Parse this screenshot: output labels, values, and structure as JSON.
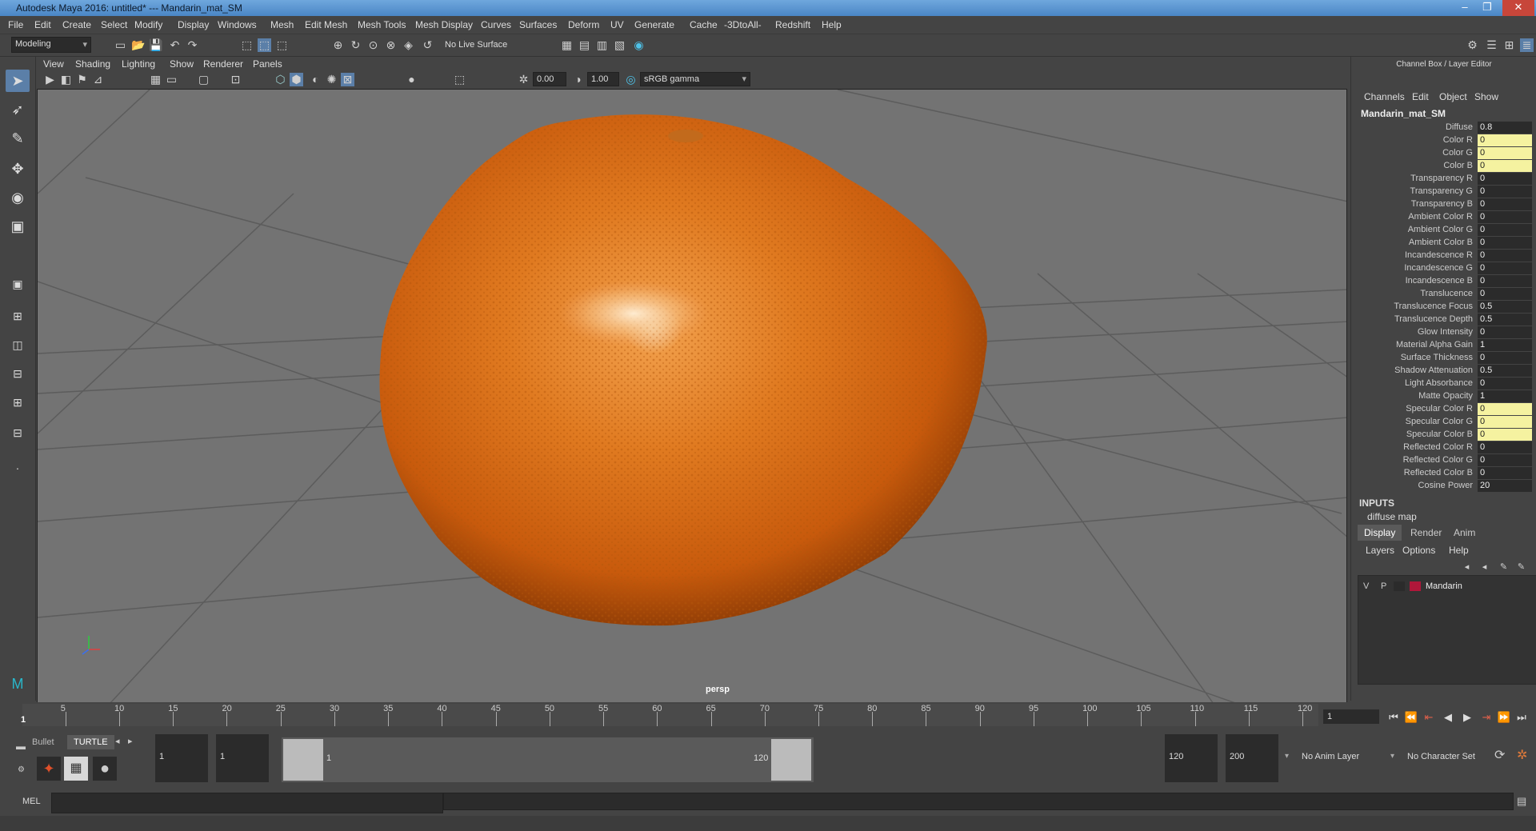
{
  "window": {
    "title": "Autodesk Maya 2016: untitled*   ---   Mandarin_mat_SM",
    "controls": [
      "–",
      "❐",
      "✕"
    ]
  },
  "menubar": [
    "File",
    "Edit",
    "Create",
    "Select",
    "Modify",
    "Display",
    "Windows",
    "Mesh",
    "Edit Mesh",
    "Mesh Tools",
    "Mesh Display",
    "Curves",
    "Surfaces",
    "Deform",
    "UV",
    "Generate",
    "Cache",
    "-3DtoAll-",
    "Redshift",
    "Help"
  ],
  "shelf": {
    "mode": "Modeling",
    "live_surface": "No Live Surface"
  },
  "viewport": {
    "menu": [
      "View",
      "Shading",
      "Lighting",
      "Show",
      "Renderer",
      "Panels"
    ],
    "exposure": "0.00",
    "gamma": "1.00",
    "color_space": "sRGB gamma",
    "camera": "persp"
  },
  "channel_box": {
    "header": "Channel Box / Layer Editor",
    "tabs": [
      "Channels",
      "Edit",
      "Object",
      "Show"
    ],
    "object": "Mandarin_mat_SM",
    "attributes": [
      {
        "name": "Diffuse",
        "value": "0.8",
        "hl": false
      },
      {
        "name": "Color R",
        "value": "0",
        "hl": true
      },
      {
        "name": "Color G",
        "value": "0",
        "hl": true
      },
      {
        "name": "Color B",
        "value": "0",
        "hl": true
      },
      {
        "name": "Transparency R",
        "value": "0",
        "hl": false
      },
      {
        "name": "Transparency G",
        "value": "0",
        "hl": false
      },
      {
        "name": "Transparency B",
        "value": "0",
        "hl": false
      },
      {
        "name": "Ambient Color R",
        "value": "0",
        "hl": false
      },
      {
        "name": "Ambient Color G",
        "value": "0",
        "hl": false
      },
      {
        "name": "Ambient Color B",
        "value": "0",
        "hl": false
      },
      {
        "name": "Incandescence R",
        "value": "0",
        "hl": false
      },
      {
        "name": "Incandescence G",
        "value": "0",
        "hl": false
      },
      {
        "name": "Incandescence B",
        "value": "0",
        "hl": false
      },
      {
        "name": "Translucence",
        "value": "0",
        "hl": false
      },
      {
        "name": "Translucence Focus",
        "value": "0.5",
        "hl": false
      },
      {
        "name": "Translucence Depth",
        "value": "0.5",
        "hl": false
      },
      {
        "name": "Glow Intensity",
        "value": "0",
        "hl": false
      },
      {
        "name": "Material Alpha Gain",
        "value": "1",
        "hl": false
      },
      {
        "name": "Surface Thickness",
        "value": "0",
        "hl": false
      },
      {
        "name": "Shadow Attenuation",
        "value": "0.5",
        "hl": false
      },
      {
        "name": "Light Absorbance",
        "value": "0",
        "hl": false
      },
      {
        "name": "Matte Opacity",
        "value": "1",
        "hl": false
      },
      {
        "name": "Specular Color R",
        "value": "0",
        "hl": true
      },
      {
        "name": "Specular Color G",
        "value": "0",
        "hl": true
      },
      {
        "name": "Specular Color B",
        "value": "0",
        "hl": true
      },
      {
        "name": "Reflected Color R",
        "value": "0",
        "hl": false
      },
      {
        "name": "Reflected Color G",
        "value": "0",
        "hl": false
      },
      {
        "name": "Reflected Color B",
        "value": "0",
        "hl": false
      },
      {
        "name": "Cosine Power",
        "value": "20",
        "hl": false
      }
    ],
    "inputs_label": "INPUTS",
    "inputs_item": "diffuse map"
  },
  "layer_editor": {
    "tabs": [
      "Display",
      "Render",
      "Anim"
    ],
    "menu": [
      "Layers",
      "Options",
      "Help"
    ],
    "layer": {
      "v": "V",
      "p": "P",
      "name": "Mandarin",
      "color": "#b0173a"
    }
  },
  "timeline": {
    "ticks": [
      "5",
      "10",
      "15",
      "20",
      "25",
      "30",
      "35",
      "40",
      "45",
      "50",
      "55",
      "60",
      "65",
      "70",
      "75",
      "80",
      "85",
      "90",
      "95",
      "100",
      "105",
      "110",
      "115",
      "120"
    ],
    "start_label": "1",
    "current_frame": "1"
  },
  "range": {
    "shelf_tabs": [
      "Bullet",
      "TURTLE"
    ],
    "start": "1",
    "anim_start": "1",
    "range_start": "1",
    "range_end": "120",
    "anim_end": "120",
    "end": "200",
    "anim_layer": "No Anim Layer",
    "character_set": "No Character Set"
  },
  "command": {
    "lang": "MEL"
  }
}
